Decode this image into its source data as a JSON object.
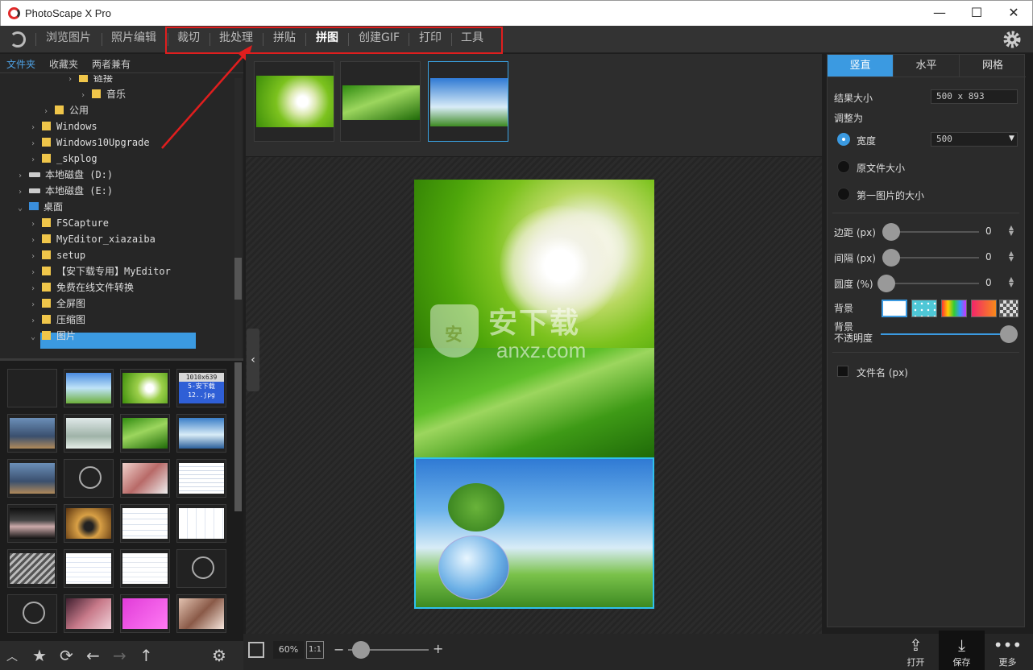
{
  "window": {
    "title": "PhotoScape X Pro",
    "minimize": "—",
    "maximize": "☐",
    "close": "✕"
  },
  "menu": {
    "items": [
      {
        "label": "浏览图片"
      },
      {
        "label": "照片编辑"
      },
      {
        "label": "裁切"
      },
      {
        "label": "批处理"
      },
      {
        "label": "拼贴"
      },
      {
        "label": "拼图"
      },
      {
        "label": "创建GIF"
      },
      {
        "label": "打印"
      },
      {
        "label": "工具"
      }
    ],
    "active": "拼图"
  },
  "left_tabs": [
    "文件夹",
    "收藏夹",
    "两者兼有"
  ],
  "tree": [
    {
      "label": "链接"
    },
    {
      "label": "音乐"
    },
    {
      "label": "公用"
    },
    {
      "label": "Windows"
    },
    {
      "label": "Windows10Upgrade"
    },
    {
      "label": "_skplog"
    },
    {
      "label": "本地磁盘 (D:)"
    },
    {
      "label": "本地磁盘 (E:)"
    },
    {
      "label": "桌面"
    },
    {
      "label": "FSCapture"
    },
    {
      "label": "MyEditor_xiazaiba"
    },
    {
      "label": "setup"
    },
    {
      "label": "【安下载专用】MyEditor"
    },
    {
      "label": "免费在线文件转换"
    },
    {
      "label": "全屏图"
    },
    {
      "label": "压缩图"
    },
    {
      "label": "图片"
    }
  ],
  "thumb_overlay": {
    "line1": "1010x639",
    "line2": "5-安下载",
    "line3": "12..jpg"
  },
  "watermark": {
    "text1": "安下载",
    "text2": "anxz.com",
    "shield": "安"
  },
  "zoom": {
    "percent": "60%",
    "one_to_one": "1:1",
    "minus": "−",
    "plus": "+"
  },
  "bottom_buttons": {
    "open": "打开",
    "save": "保存",
    "more": "更多"
  },
  "right": {
    "tabs": [
      "竖直",
      "水平",
      "网格"
    ],
    "active_tab": "竖直",
    "result_size_label": "结果大小",
    "result_size_value": "500 x 893",
    "adjust_label": "调整为",
    "radio_width": "宽度",
    "width_value": "500",
    "radio_original": "原文件大小",
    "radio_first": "第一图片的大小",
    "margin_label": "边距 (px)",
    "margin_value": "0",
    "spacing_label": "间隔 (px)",
    "spacing_value": "0",
    "roundness_label": "圆度 (%)",
    "roundness_value": "0",
    "background_label": "背景",
    "opacity_label_1": "背景",
    "opacity_label_2": "不透明度",
    "opacity_value": 1.0,
    "filename_label": "文件名 (px)"
  },
  "colors": {
    "accent": "#3b9ae1",
    "highlight_box": "#e01e1e",
    "selected_border": "#2ec1ee"
  }
}
